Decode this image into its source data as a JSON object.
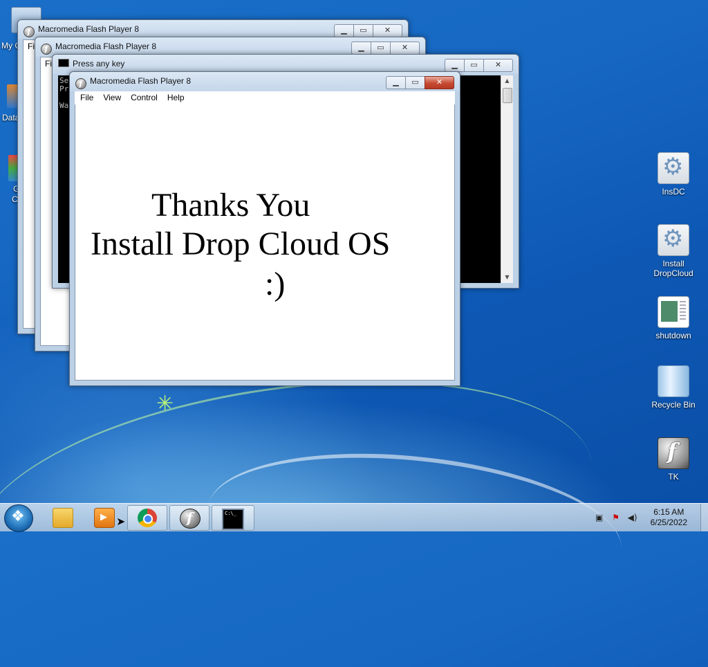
{
  "desktop": {
    "left_icons": [
      {
        "label": "My C"
      },
      {
        "label": "Data"
      },
      {
        "label": "G"
      },
      {
        "label": "C"
      }
    ],
    "right_icons": [
      {
        "label": "InsDC",
        "icon": "gear-icon"
      },
      {
        "label": "Install DropCloud",
        "icon": "gear-icon"
      },
      {
        "label": "shutdown",
        "icon": "screenshot-icon"
      },
      {
        "label": "Recycle Bin",
        "icon": "recycle-bin-icon"
      },
      {
        "label": "TK",
        "icon": "flash-icon"
      }
    ]
  },
  "windows": {
    "flash_back_1": {
      "title": "Macromedia Flash Player 8",
      "menu_first": "Fi"
    },
    "flash_back_2": {
      "title": "Macromedia Flash Player 8",
      "menu_first": "Fi"
    },
    "console": {
      "title": "Press any key",
      "lines": [
        "Se",
        "Pr",
        "",
        "Wa"
      ]
    },
    "flash_main": {
      "title": "Macromedia Flash Player 8",
      "menu": [
        "File",
        "View",
        "Control",
        "Help"
      ],
      "message": [
        "Thanks You",
        "Install Drop Cloud OS",
        ":)"
      ]
    },
    "caption_buttons": {
      "minimize": "▁",
      "maximize": "▭",
      "close": "✕"
    }
  },
  "taskbar": {
    "pinned": [
      "start-button",
      "explorer",
      "media-player",
      "chrome",
      "flash-player",
      "command-prompt"
    ],
    "clock": {
      "time": "6:15 AM",
      "date": "6/25/2022"
    }
  }
}
